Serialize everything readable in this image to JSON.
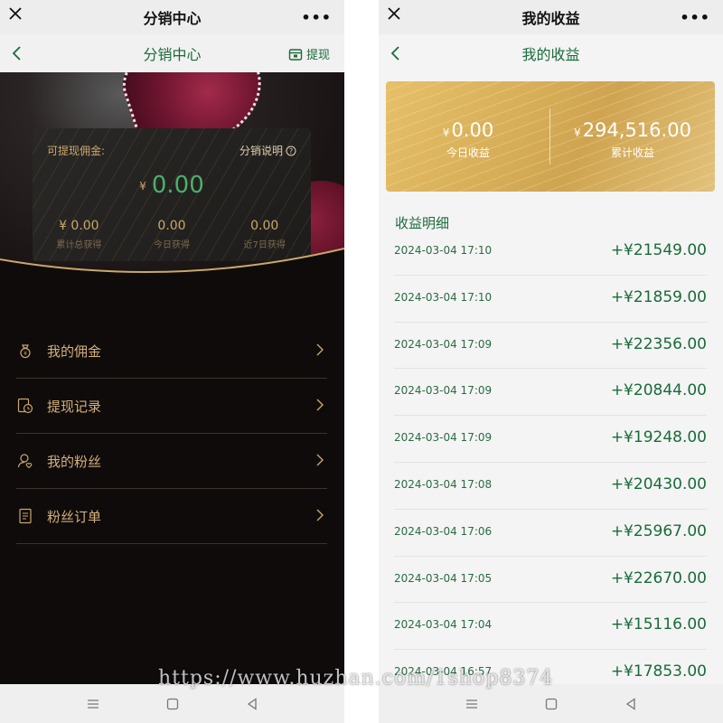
{
  "left": {
    "topbar_title": "分销中心",
    "nav_title": "分销中心",
    "withdraw_label": "提现",
    "card": {
      "label": "可提现佣金:",
      "explain_label": "分销说明",
      "currency": "¥",
      "amount": "0.00",
      "stats": [
        {
          "value": "¥ 0.00",
          "key": "累计总获得"
        },
        {
          "value": "0.00",
          "key": "今日获得"
        },
        {
          "value": "0.00",
          "key": "近7日获得"
        }
      ]
    },
    "menu": [
      {
        "label": "我的佣金",
        "icon": "money-bag-icon"
      },
      {
        "label": "提现记录",
        "icon": "history-icon"
      },
      {
        "label": "我的粉丝",
        "icon": "fans-icon"
      },
      {
        "label": "粉丝订单",
        "icon": "order-icon"
      }
    ]
  },
  "right": {
    "topbar_title": "我的收益",
    "nav_title": "我的收益",
    "today": {
      "currency": "¥",
      "value": "0.00",
      "key": "今日收益"
    },
    "total": {
      "currency": "¥",
      "value": "294,516.00",
      "key": "累计收益"
    },
    "detail_title": "收益明细",
    "records": [
      {
        "date": "2024-03-04 17:10",
        "amount": "+¥21549.00"
      },
      {
        "date": "2024-03-04 17:10",
        "amount": "+¥21859.00"
      },
      {
        "date": "2024-03-04 17:09",
        "amount": "+¥22356.00"
      },
      {
        "date": "2024-03-04 17:09",
        "amount": "+¥20844.00"
      },
      {
        "date": "2024-03-04 17:09",
        "amount": "+¥19248.00"
      },
      {
        "date": "2024-03-04 17:08",
        "amount": "+¥20430.00"
      },
      {
        "date": "2024-03-04 17:06",
        "amount": "+¥25967.00"
      },
      {
        "date": "2024-03-04 17:05",
        "amount": "+¥22670.00"
      },
      {
        "date": "2024-03-04 17:04",
        "amount": "+¥15116.00"
      },
      {
        "date": "2024-03-04 16:57",
        "amount": "+¥17853.00"
      }
    ]
  },
  "watermark": "https://www.huzhan.com/1shop8374",
  "colors": {
    "accent_green": "#1a6b3a",
    "gold": "#c9a86a",
    "amount_green": "#4caf6a"
  }
}
